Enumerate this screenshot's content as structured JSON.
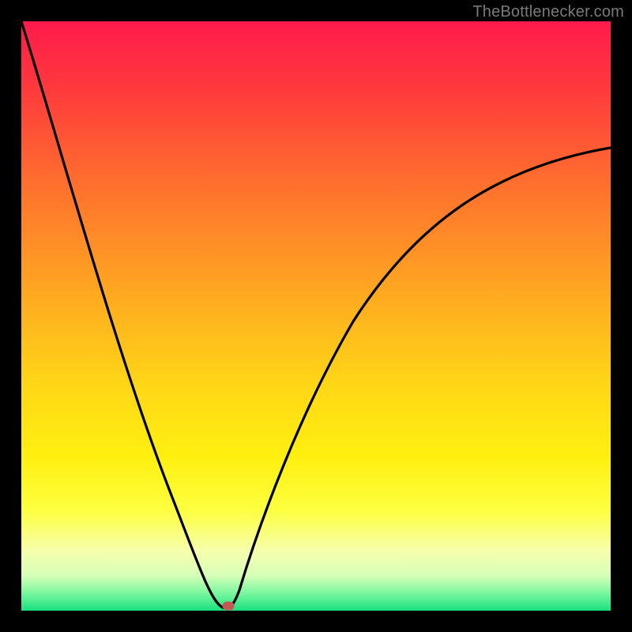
{
  "watermark": "TheBottlenecker.com",
  "chart_data": {
    "type": "line",
    "title": "",
    "xlabel": "",
    "ylabel": "",
    "xlim": [
      0,
      100
    ],
    "ylim": [
      0,
      100
    ],
    "series": [
      {
        "name": "bottleneck-curve",
        "x": [
          0,
          3,
          6,
          9,
          12,
          15,
          18,
          21,
          24,
          27,
          30,
          32,
          34,
          35,
          36,
          38,
          40,
          44,
          48,
          52,
          56,
          60,
          64,
          68,
          72,
          76,
          80,
          84,
          88,
          92,
          96,
          100
        ],
        "y": [
          100,
          90,
          80,
          70,
          61,
          52,
          44,
          35,
          27,
          19,
          12,
          7,
          3,
          1,
          2,
          6,
          11,
          21,
          30,
          38,
          45,
          51,
          56,
          60,
          64,
          67,
          70,
          72,
          74,
          76,
          77,
          78
        ]
      }
    ],
    "marker": {
      "x": 35,
      "y": 1
    },
    "gradient_stops": [
      {
        "pos": 0.0,
        "color": "#ff1a4b"
      },
      {
        "pos": 0.5,
        "color": "#ffd716"
      },
      {
        "pos": 0.9,
        "color": "#f6ffae"
      },
      {
        "pos": 1.0,
        "color": "#18e07f"
      }
    ]
  }
}
